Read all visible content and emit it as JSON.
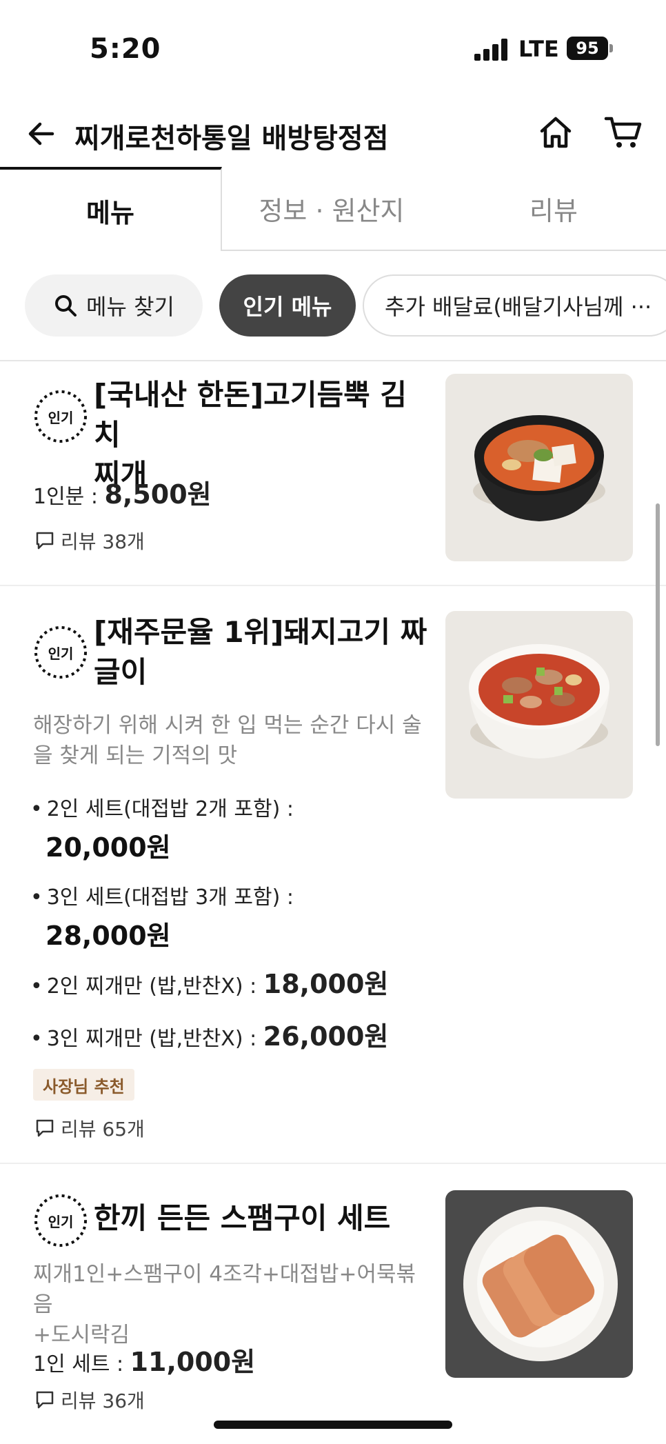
{
  "status_bar": {
    "time": "5:20",
    "network": "LTE",
    "battery": "95"
  },
  "header": {
    "title": "찌개로천하통일 배방탕정점"
  },
  "tabs": [
    {
      "label": "메뉴",
      "active": true
    },
    {
      "label": "정보 · 원산지",
      "active": false
    },
    {
      "label": "리뷰",
      "active": false
    }
  ],
  "chips": {
    "search": "메뉴 찾기",
    "popular": "인기 메뉴",
    "extra": "추가 배달료(배달기사님께 ···"
  },
  "popular_badge": "인기",
  "items": [
    {
      "name_line1": "[국내산 한돈]고기듬뿍 김치",
      "name_line2": "찌개",
      "price_label": "1인분 : ",
      "price": "8,500원",
      "review": "리뷰 38개"
    },
    {
      "name_line1": "[재주문율 1위]돼지고기 짜",
      "name_line2": "글이",
      "desc_line1": "해장하기 위해 시켜 한 입 먹는 순간 다시 술",
      "desc_line2": "을 찾게 되는 기적의 맛",
      "options": [
        {
          "label": "2인 세트(대접밥 2개 포함) :",
          "price": "20,000원"
        },
        {
          "label": "3인 세트(대접밥 3개 포함) :",
          "price": "28,000원"
        },
        {
          "label": "2인 찌개만 (밥,반찬X) : ",
          "price": "18,000원"
        },
        {
          "label": "3인 찌개만 (밥,반찬X) : ",
          "price": "26,000원"
        }
      ],
      "owner_badge": "사장님 추천",
      "review": "리뷰 65개"
    },
    {
      "name_line1": "한끼 든든 스팸구이 세트",
      "desc_line1": "찌개1인+스팸구이 4조각+대접밥+어묵볶음",
      "desc_line2": "+도시락김",
      "price_label": "1인 세트 : ",
      "price": "11,000원",
      "review": "리뷰 36개"
    }
  ]
}
